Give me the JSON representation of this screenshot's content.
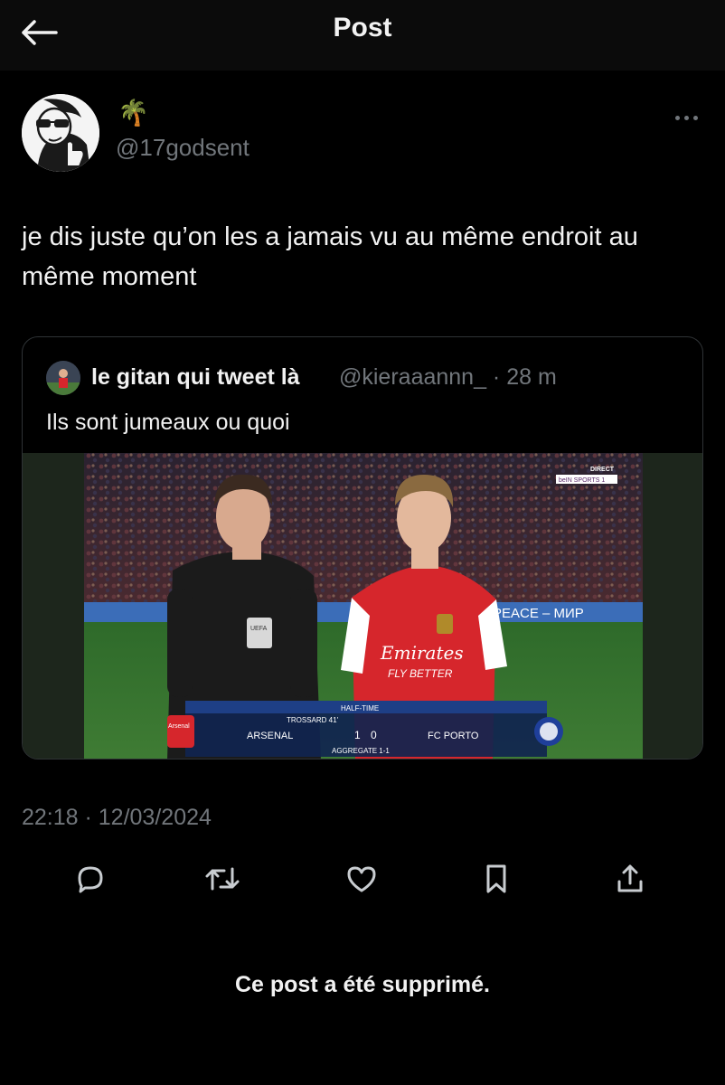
{
  "header": {
    "title": "Post"
  },
  "author": {
    "emoji": "🌴",
    "handle": "@17godsent"
  },
  "post": {
    "text": "je dis juste qu’on les a jamais vu au même endroit au même moment",
    "timestamp": "22:18 · 12/03/2024"
  },
  "quoted": {
    "name": "le gitan qui tweet là",
    "handle": "@kieraaannn_ · 28 m",
    "text": "Ils sont jumeaux ou quoi",
    "media": {
      "broadcast_top": "DIRECT",
      "broadcast_channel": "beIN SPORTS 1",
      "board_text": "PEACE – МИР",
      "sponsor_line1": "Emirates",
      "sponsor_line2": "FLY BETTER",
      "badge_text": "UEFA",
      "score_header": "HALF-TIME",
      "scorer": "TROSSARD 41'",
      "home_team": "ARSENAL",
      "away_team": "FC PORTO",
      "home_score": "1",
      "away_score": "0",
      "aggregate": "AGGREGATE 1-1",
      "home_crest": "Arsenal"
    }
  },
  "actions": {
    "reply": "reply-icon",
    "repost": "repost-icon",
    "like": "heart-icon",
    "bookmark": "bookmark-icon",
    "share": "share-icon"
  },
  "footer": {
    "notice": "Ce post a été supprimé."
  },
  "colors": {
    "background": "#000000",
    "text": "#e7e9ea",
    "muted": "#71767b",
    "border": "#2f3336",
    "arsenal_red": "#d6262c"
  }
}
